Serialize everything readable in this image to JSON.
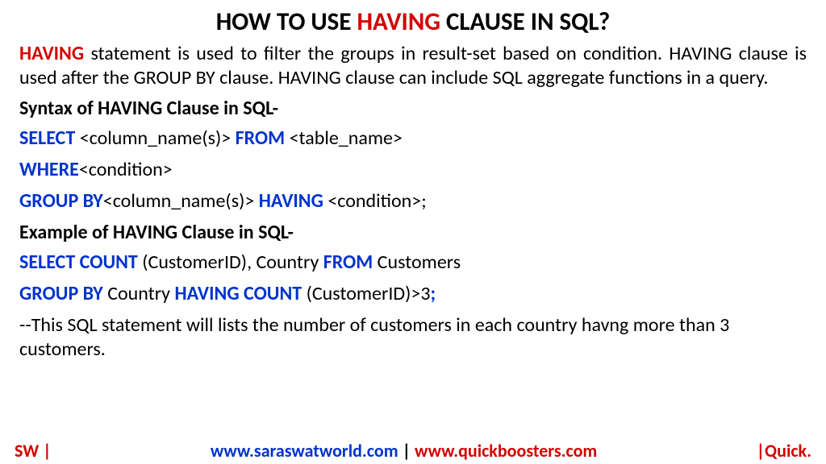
{
  "title": {
    "before": "HOW TO USE ",
    "highlight": "HAVING",
    "after": " CLAUSE IN SQL?"
  },
  "description": {
    "lead": "HAVING",
    "rest": " statement is used to filter the groups in result-set based on condition. HAVING clause is used after the GROUP BY clause. HAVING clause can include SQL aggregate functions in a query."
  },
  "syntax": {
    "heading": "Syntax of HAVING Clause in SQL-",
    "line1": {
      "kw1": "SELECT",
      "t1": " <column_name(s)> ",
      "kw2": "FROM",
      "t2": " <table_name>"
    },
    "line2": {
      "kw1": "WHERE",
      "t1": "<condition>"
    },
    "line3": {
      "kw1": "GROUP BY",
      "t1": "<column_name(s)> ",
      "kw2": "HAVING",
      "t2": " <condition>;"
    }
  },
  "example": {
    "heading": "Example of HAVING Clause in SQL-",
    "line1": {
      "kw1": "SELECT COUNT",
      "t1": " (CustomerID), Country ",
      "kw2": "FROM",
      "t2": " Customers"
    },
    "line2": {
      "kw1": "GROUP BY",
      "t1": " Country ",
      "kw2": "HAVING COUNT",
      "t2": " (CustomerID)>3",
      "kw3": ";"
    },
    "comment": "--This SQL statement will lists the number of customers in each country havng more than 3 customers."
  },
  "footer": {
    "left": "SW |",
    "mid_blue": "www.saraswatworld.com",
    "mid_sep": " | ",
    "mid_red": "www.quickboosters.com",
    "right": "|Quick."
  }
}
